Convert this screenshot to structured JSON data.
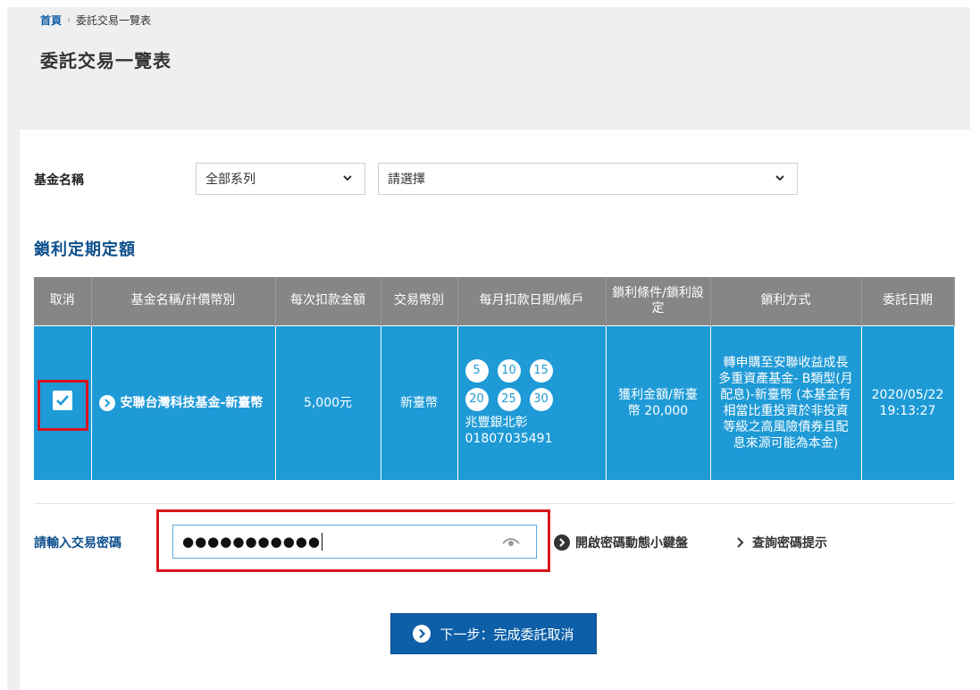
{
  "breadcrumb": {
    "home": "首頁",
    "current": "委託交易一覽表"
  },
  "page_title": "委託交易一覽表",
  "filter": {
    "label": "基金名稱",
    "series_select": "全部系列",
    "fund_select": "請選擇"
  },
  "section_title": "鎖利定期定額",
  "table": {
    "headers": [
      "取消",
      "基金名稱/計價幣別",
      "每次扣款金額",
      "交易幣別",
      "每月扣款日期/帳戶",
      "鎖利條件/鎖利設定",
      "鎖利方式",
      "委託日期"
    ],
    "row": {
      "cancel_checked": true,
      "fund_name": "安聯台灣科技基金-新臺幣",
      "amount": "5,000元",
      "currency": "新臺幣",
      "days": [
        "5",
        "10",
        "15",
        "20",
        "25",
        "30"
      ],
      "bank": "兆豐銀北彰",
      "account": "01807035491",
      "lock_condition": "獲利金額/新臺幣 20,000",
      "lock_method": "轉申購至安聯收益成長多重資產基金- B類型(月配息)-新臺幣 (本基金有相當比重投資於非投資等級之高風險債券且配息來源可能為本金)",
      "date": "2020/05/22",
      "time": "19:13:27"
    }
  },
  "password": {
    "label": "請輸入交易密碼",
    "masked_value": "●●●●●●●●●●●",
    "keyboard_link": "開啟密碼動態小鍵盤",
    "hint_link": "查詢密碼提示"
  },
  "next_button": "下一步：完成委託取消",
  "colors": {
    "primary": "#0d5fa8",
    "row_bg": "#1e9ad6",
    "header_bg": "#868686",
    "highlight": "#d9141b"
  }
}
